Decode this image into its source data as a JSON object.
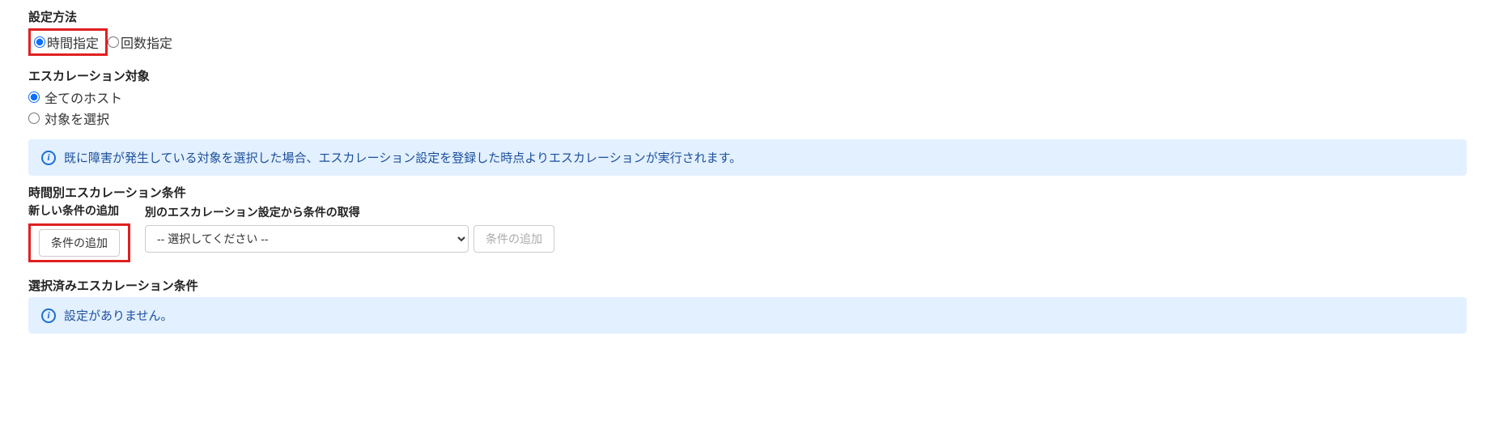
{
  "settingMethod": {
    "label": "設定方法",
    "options": {
      "time": "時間指定",
      "count": "回数指定"
    }
  },
  "escalationTarget": {
    "label": "エスカレーション対象",
    "options": {
      "all": "全てのホスト",
      "select": "対象を選択"
    }
  },
  "infoBanner1": "既に障害が発生している対象を選択した場合、エスカレーション設定を登録した時点よりエスカレーションが実行されます。",
  "timeConditions": {
    "label": "時間別エスカレーション条件",
    "addNew": {
      "label": "新しい条件の追加",
      "button": "条件の追加"
    },
    "fromOther": {
      "label": "別のエスカレーション設定から条件の取得",
      "selectPlaceholder": "-- 選択してください --",
      "button": "条件の追加"
    }
  },
  "selectedConditions": {
    "label": "選択済みエスカレーション条件",
    "emptyMessage": "設定がありません。"
  }
}
